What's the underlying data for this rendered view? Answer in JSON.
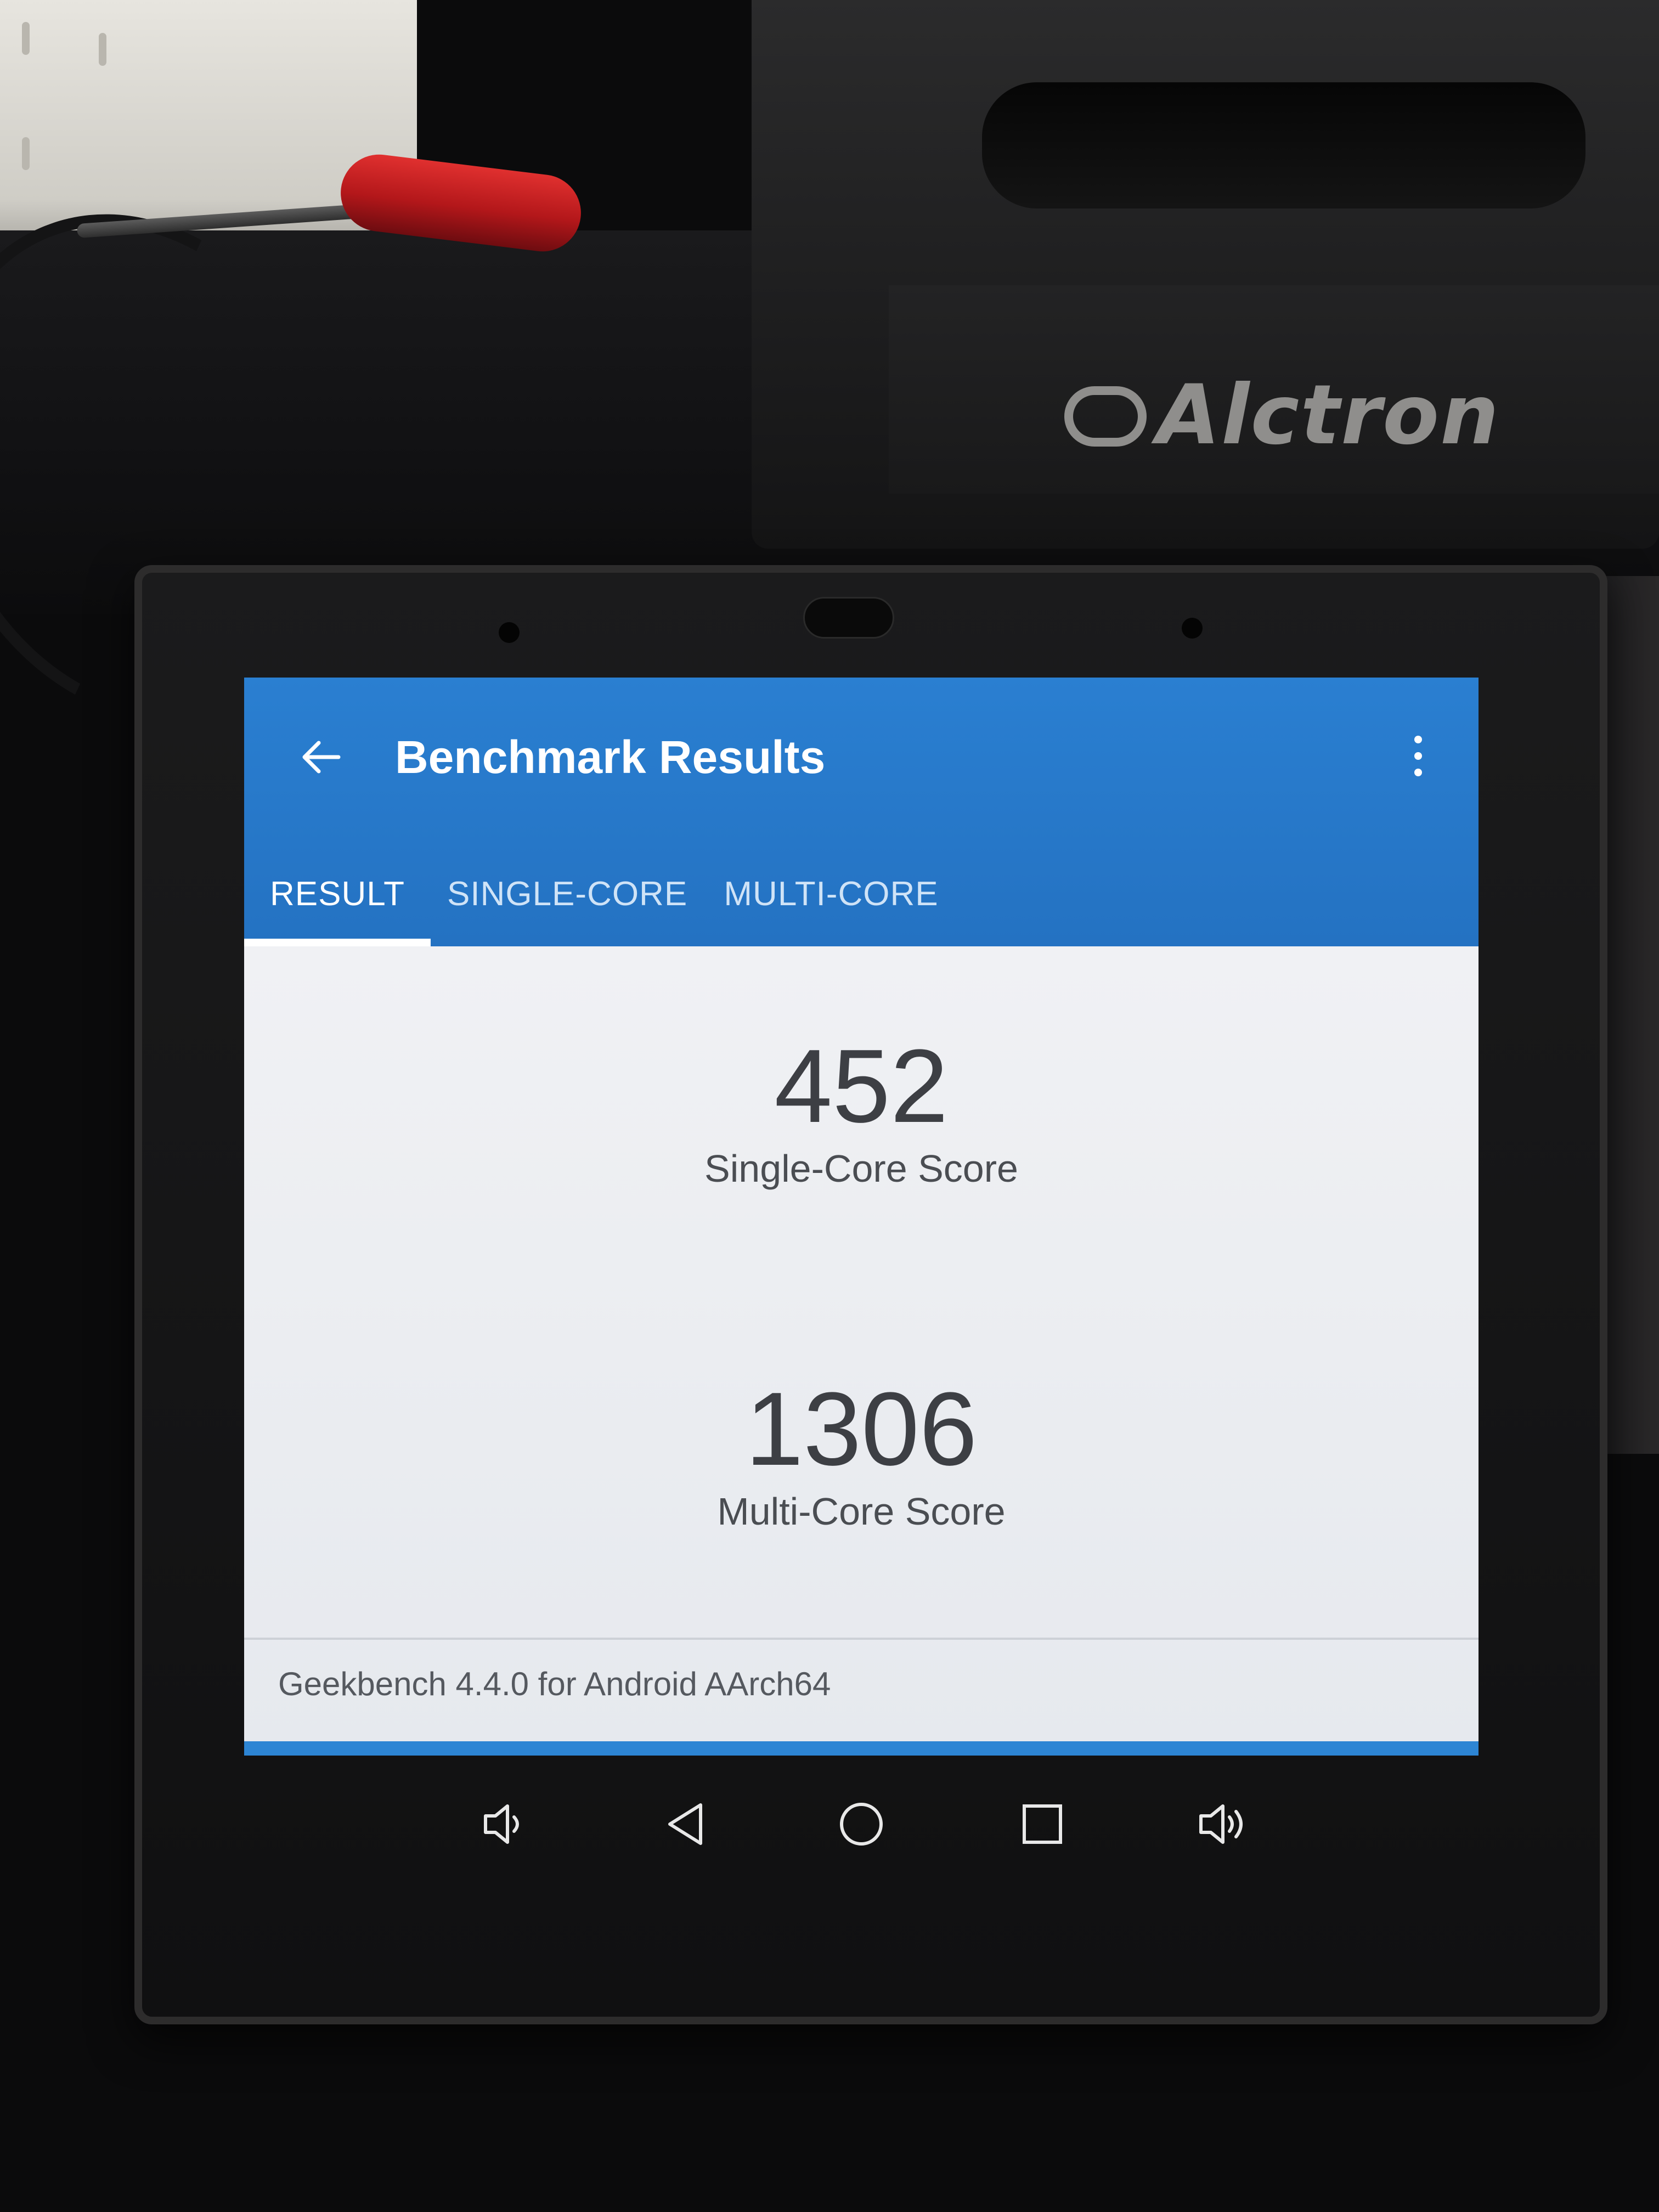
{
  "background": {
    "speaker_brand": "Alctron"
  },
  "app": {
    "title": "Benchmark Results",
    "back_icon": "arrow-left-icon",
    "menu_icon": "more-vert-icon",
    "accent_color": "#2a7fd1"
  },
  "tabs": [
    {
      "label": "RESULT",
      "active": true
    },
    {
      "label": "SINGLE-CORE",
      "active": false
    },
    {
      "label": "MULTI-CORE",
      "active": false
    }
  ],
  "results": {
    "single_core": {
      "value": "452",
      "label": "Single-Core Score"
    },
    "multi_core": {
      "value": "1306",
      "label": "Multi-Core Score"
    }
  },
  "footer": {
    "text": "Geekbench 4.4.0 for Android AArch64"
  },
  "navbar": {
    "buttons": [
      {
        "name": "volume-down-icon"
      },
      {
        "name": "back-triangle-icon"
      },
      {
        "name": "home-circle-icon"
      },
      {
        "name": "recents-square-icon"
      },
      {
        "name": "volume-up-icon"
      }
    ]
  }
}
